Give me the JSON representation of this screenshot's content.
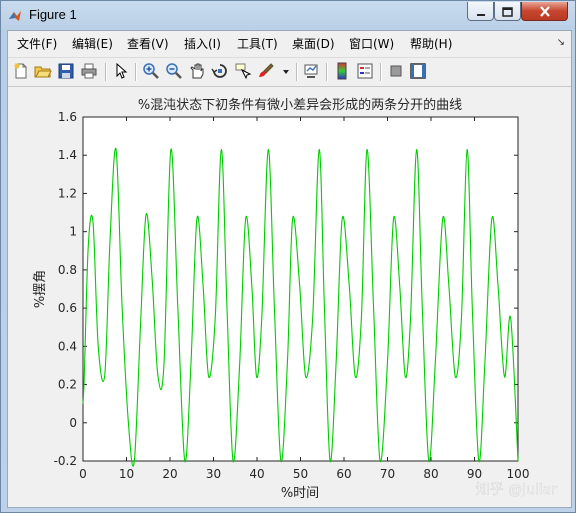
{
  "window": {
    "title": "Figure 1"
  },
  "menu": [
    "文件(F)",
    "编辑(E)",
    "查看(V)",
    "插入(I)",
    "工具(T)",
    "桌面(D)",
    "窗口(W)",
    "帮助(H)"
  ],
  "toolbar": {
    "icons": [
      "new-figure-icon",
      "open-icon",
      "save-icon",
      "print-icon",
      "pointer-icon",
      "zoom-in-icon",
      "zoom-out-icon",
      "pan-icon",
      "rotate-icon",
      "data-cursor-icon",
      "brush-icon",
      "link-icon",
      "colorbar-icon",
      "legend-icon",
      "hide-plot-tools-icon",
      "show-plot-tools-icon"
    ]
  },
  "watermark": "知乎 @juliar",
  "colors": {
    "line": "#00cc00",
    "axes_bg": "#ffffff",
    "figure_bg": "#f0f0f0"
  },
  "chart_data": {
    "type": "line",
    "title": "%混沌状态下初条件有微小差异会形成的两条分开的曲线",
    "xlabel": "%时间",
    "ylabel": "%摆角",
    "xlim": [
      0,
      100
    ],
    "ylim": [
      -0.2,
      1.6
    ],
    "xticks": [
      "0",
      "10",
      "20",
      "30",
      "40",
      "50",
      "60",
      "70",
      "80",
      "90",
      "100"
    ],
    "yticks": [
      "-0.2",
      "0",
      "0.2",
      "0.4",
      "0.6",
      "0.8",
      "1",
      "1.2",
      "1.4",
      "1.6"
    ],
    "grid": false,
    "series": [
      {
        "color": "#00cc00",
        "x": [
          0,
          0.3,
          1.2,
          2.3,
          3.5,
          5.0,
          6.2,
          7.6,
          9.0,
          10.5,
          11.8,
          13.2,
          14.5,
          15.9,
          17.2,
          18.6,
          20.2,
          21.8,
          23.4,
          24.8,
          26.2,
          27.6,
          28.9,
          30.4,
          31.8,
          33.1,
          34.5,
          36.0,
          37.4,
          38.8,
          39.9,
          41.1,
          42.6,
          44.0,
          45.5,
          47.0,
          48.2,
          49.8,
          51.2,
          52.8,
          54.3,
          55.5,
          56.8,
          58.2,
          59.6,
          61.2,
          62.6,
          64.0,
          65.3,
          66.8,
          68.3,
          70.0,
          71.4,
          72.8,
          74.1,
          75.3,
          76.7,
          78.0,
          79.5,
          81.0,
          82.7,
          84.1,
          85.6,
          87.0,
          88.3,
          89.5,
          91.0,
          92.4,
          94.0,
          95.4,
          96.9,
          98.3,
          100.0
        ],
        "y": [
          0.1,
          0.25,
          0.92,
          1.05,
          0.4,
          0.25,
          0.95,
          1.43,
          0.6,
          -0.02,
          -0.2,
          0.5,
          1.09,
          0.75,
          0.25,
          0.3,
          1.43,
          0.6,
          -0.2,
          0.3,
          1.07,
          0.72,
          0.24,
          0.55,
          1.43,
          0.6,
          -0.2,
          0.3,
          1.07,
          0.72,
          0.24,
          0.55,
          1.43,
          0.6,
          -0.2,
          0.32,
          1.07,
          0.72,
          0.24,
          0.55,
          1.43,
          0.6,
          -0.2,
          0.32,
          1.07,
          0.72,
          0.24,
          0.55,
          1.43,
          0.6,
          -0.2,
          0.32,
          1.07,
          0.72,
          0.24,
          0.55,
          1.43,
          0.6,
          -0.2,
          0.32,
          1.07,
          0.72,
          0.24,
          0.55,
          1.43,
          0.6,
          -0.2,
          0.32,
          1.07,
          0.72,
          0.24,
          0.55,
          -0.2
        ]
      }
    ]
  }
}
